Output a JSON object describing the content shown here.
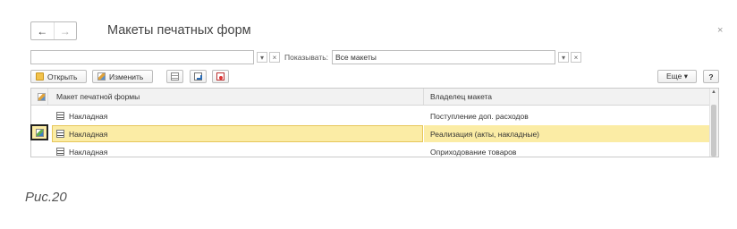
{
  "window": {
    "title": "Макеты печатных форм",
    "back_glyph": "←",
    "forward_glyph": "→",
    "close_glyph": "×"
  },
  "filter": {
    "search_value": "",
    "dropdown_glyph": "▾",
    "clear_glyph": "×",
    "show_label": "Показывать:",
    "show_value": "Все макеты"
  },
  "toolbar": {
    "open_label": "Открыть",
    "edit_label": "Изменить",
    "more_label": "Еще ▾",
    "help_label": "?"
  },
  "table": {
    "columns": [
      "Макет печатной формы",
      "Владелец макета"
    ],
    "rows": [
      {
        "name": "Накладная",
        "owner": "Поступление доп. расходов",
        "selected": false
      },
      {
        "name": "Накладная",
        "owner": "Реализация (акты, накладные)",
        "selected": true
      },
      {
        "name": "Накладная",
        "owner": "Оприходование товаров",
        "selected": false
      }
    ]
  },
  "caption": "Рис.20",
  "colors": {
    "selected_row": "#fbeca5",
    "selected_border": "#e7c65a",
    "header_bg": "#f2f2f2"
  }
}
